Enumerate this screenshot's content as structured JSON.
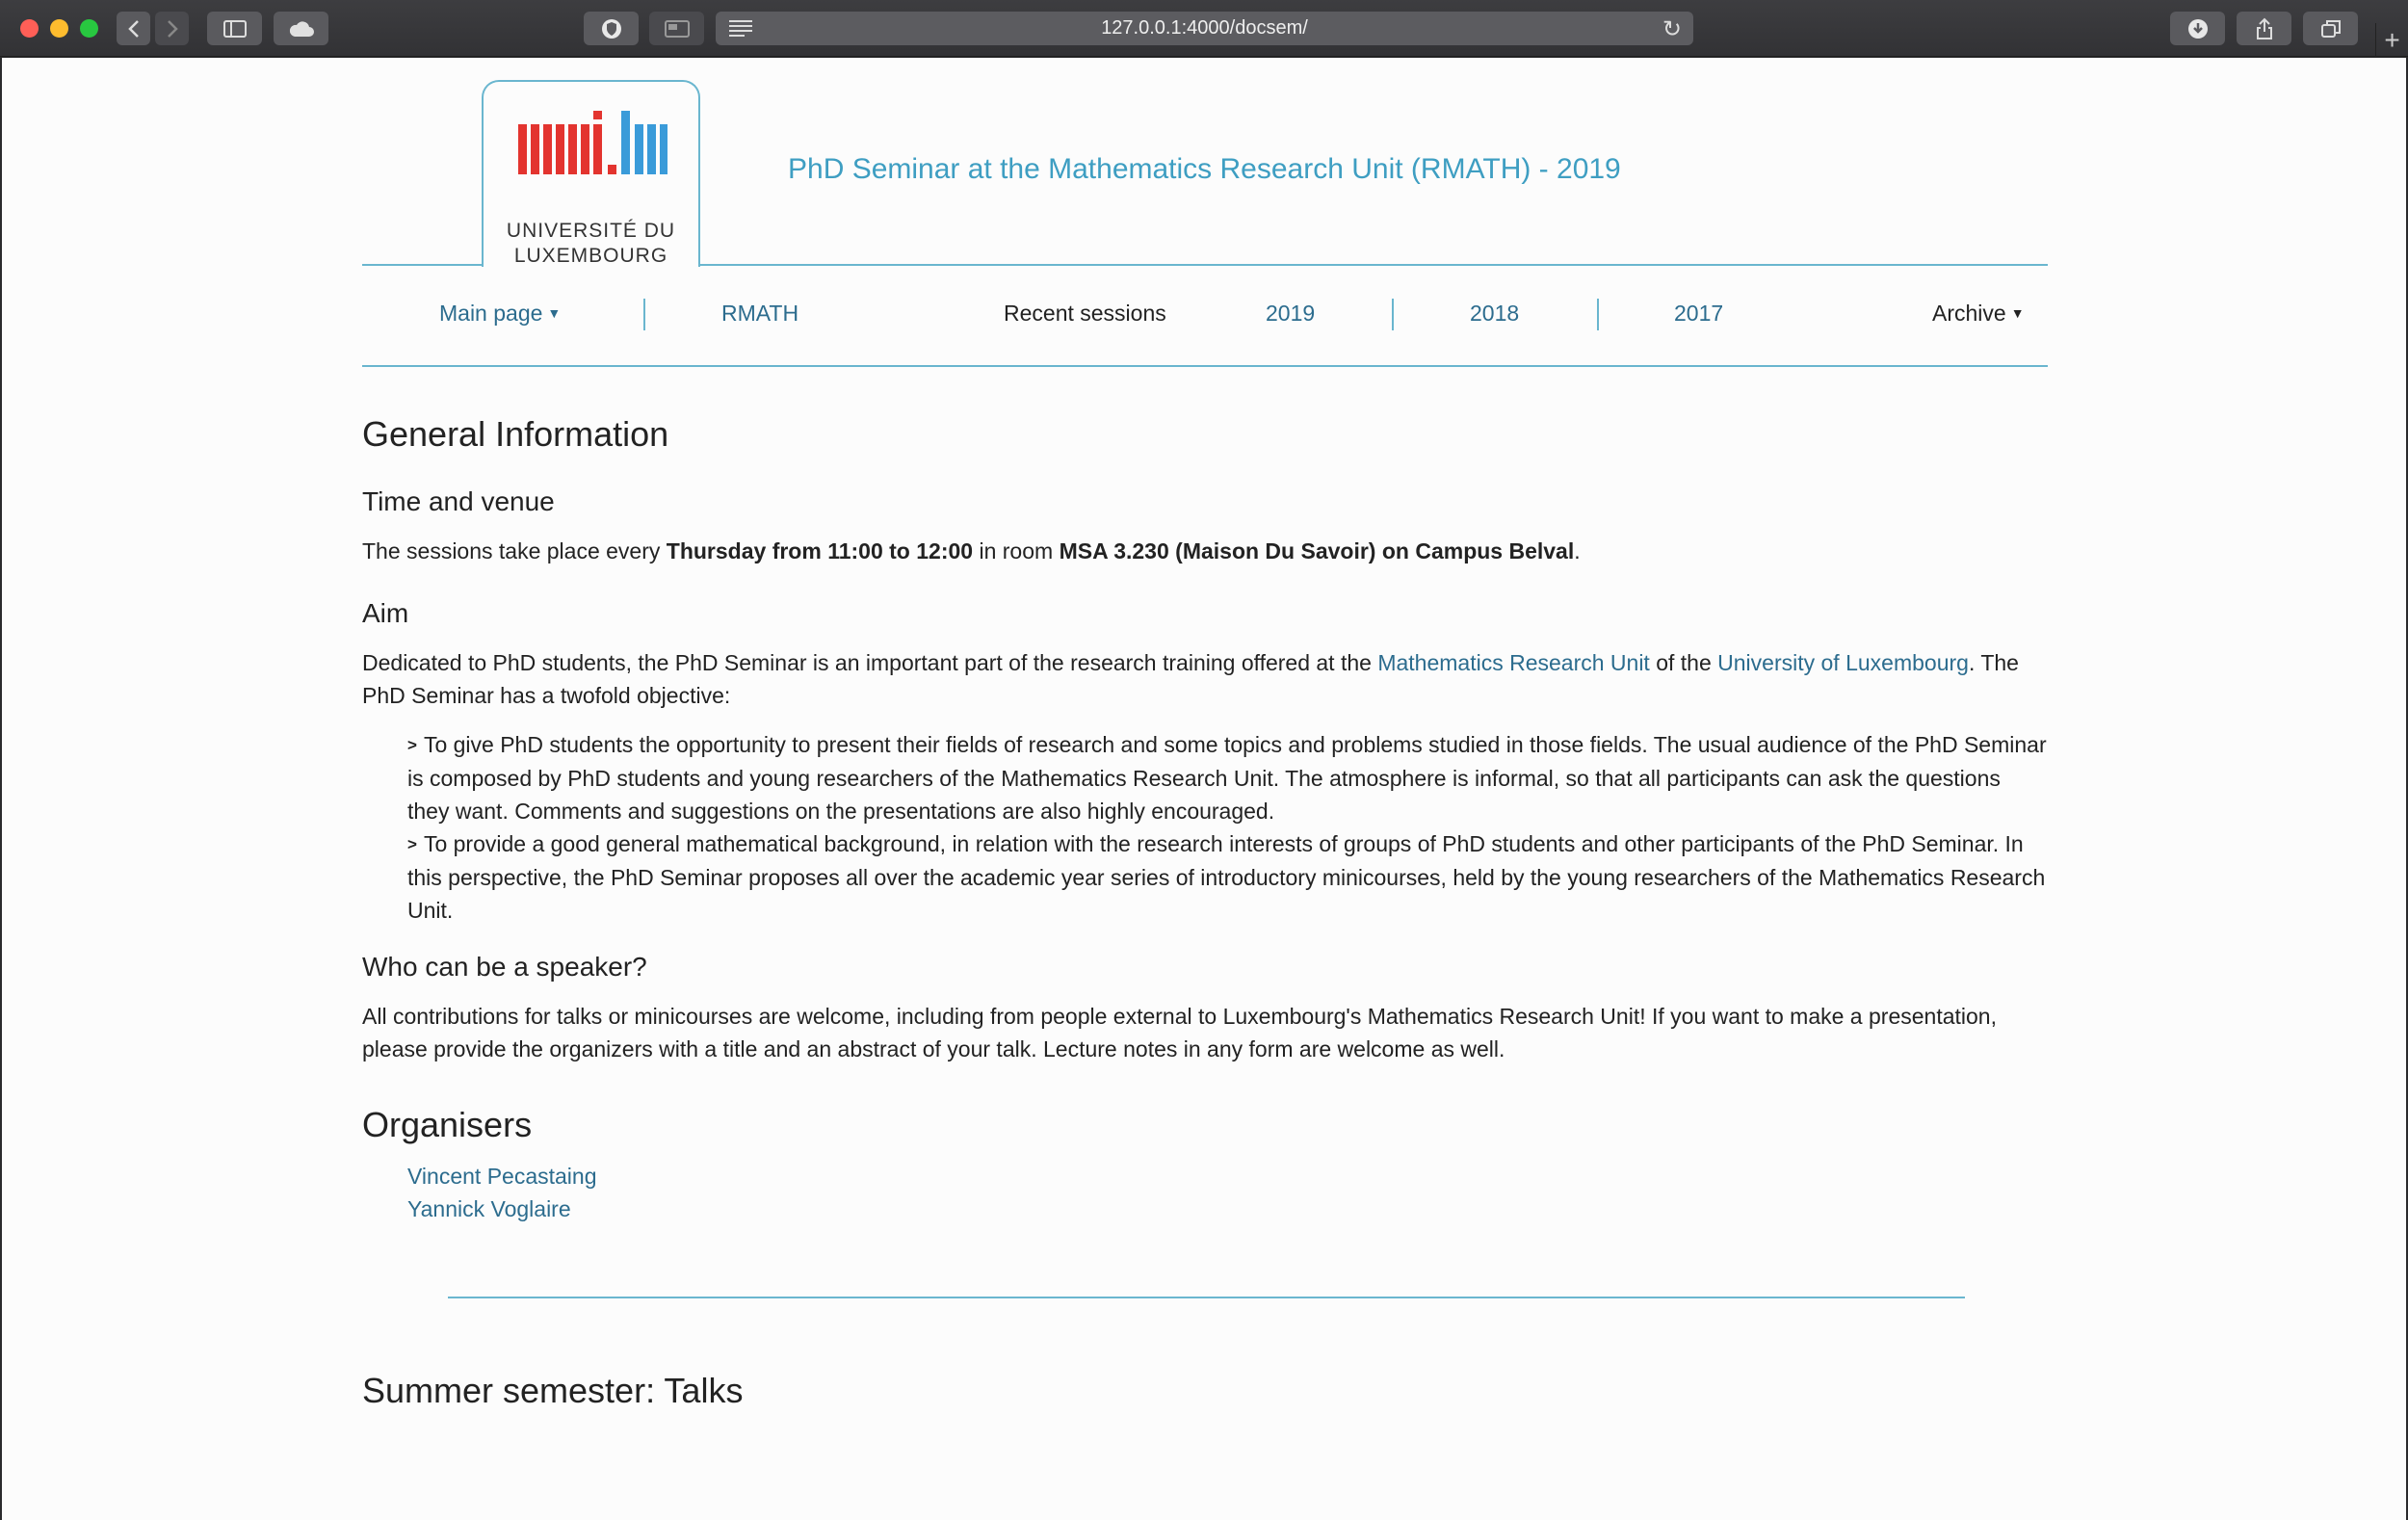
{
  "browser": {
    "url": "127.0.0.1:4000/docsem/"
  },
  "logo": {
    "mark": "uni.lu",
    "line1": "UNIVERSITÉ DU",
    "line2": "LUXEMBOURG",
    "colors": {
      "red": "#e3342f",
      "blue": "#3a9bd9"
    }
  },
  "header": {
    "title": "PhD Seminar at the Mathematics Research Unit (RMATH) - 2019"
  },
  "nav": {
    "main_page": "Main page",
    "rmath": "RMATH",
    "recent_sessions": "Recent sessions",
    "y2019": "2019",
    "y2018": "2018",
    "y2017": "2017",
    "archive": "Archive"
  },
  "general": {
    "heading": "General Information",
    "time_venue": {
      "heading": "Time and venue",
      "t1": "The sessions take place every ",
      "b1": "Thursday from 11:00 to 12:00",
      "t2": " in room ",
      "b2": "MSA 3.230 (Maison Du Savoir) on Campus Belval",
      "t3": "."
    },
    "aim": {
      "heading": "Aim",
      "t1": "Dedicated to PhD students, the PhD Seminar is an important part of the research training offered at the ",
      "link1": "Mathematics Research Unit",
      "t2": " of the ",
      "link2": "University of Luxembourg",
      "t3": ". The PhD Seminar has a twofold objective:",
      "objectives": [
        "To give PhD students the opportunity to present their fields of research and some topics and problems studied in those fields. The usual audience of the PhD Seminar is composed by PhD students and young researchers of the Mathematics Research Unit. The atmosphere is informal, so that all participants can ask the questions they want. Comments and suggestions on the presentations are also highly encouraged.",
        "To provide a good general mathematical background, in relation with the research interests of groups of PhD students and other participants of the PhD Seminar. In this perspective, the PhD Seminar proposes all over the academic year series of introductory minicourses, held by the young researchers of the Mathematics Research Unit."
      ]
    },
    "speaker": {
      "heading": "Who can be a speaker?",
      "text": "All contributions for talks or minicourses are welcome, including from people external to Luxembourg's Mathematics Research Unit! If you want to make a presentation, please provide the organizers with a title and an abstract of your talk. Lecture notes in any form are welcome as well."
    }
  },
  "organisers": {
    "heading": "Organisers",
    "names": [
      "Vincent Pecastaing",
      "Yannick Voglaire"
    ]
  },
  "summer": {
    "heading": "Summer semester: Talks"
  }
}
